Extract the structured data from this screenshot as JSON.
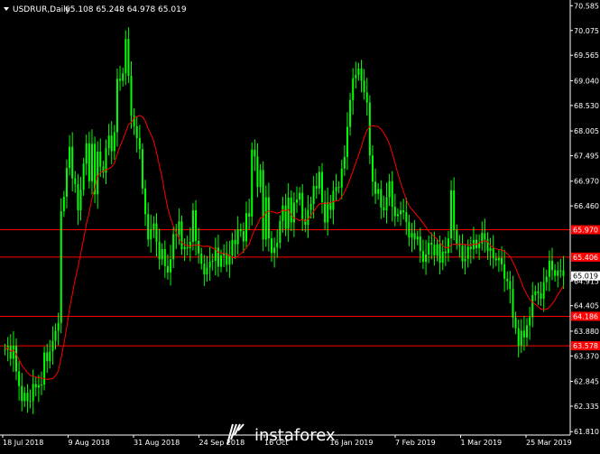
{
  "header": {
    "symbol_timeframe": "USDRUR,Daily",
    "ohlc": "65.108 65.248 64.978 65.019",
    "dropdown_icon": "triangle-down-icon"
  },
  "colors": {
    "background": "#000000",
    "candle": "#00ff00",
    "ma": "#ff0000",
    "hline": "#ff0000",
    "price_badge_bg": "#ffffff",
    "price_badge_text": "#000000",
    "level_badge_bg": "#ff0000",
    "level_badge_text": "#ffffff",
    "axis": "#ffffff",
    "axis_text": "#ffffff",
    "watermark": "#ffffff"
  },
  "watermark": {
    "text": "instaforex",
    "icon": "instaforex-logo-icon"
  },
  "chart_data": {
    "type": "candlestick",
    "timeframe": "Daily",
    "symbol": "USDRUR",
    "last_price": 65.019,
    "ylim": [
      61.74,
      70.61
    ],
    "y_ticks": [
      {
        "value": 70.585,
        "label": "70.585"
      },
      {
        "value": 70.075,
        "label": "70.075"
      },
      {
        "value": 69.565,
        "label": "69.565"
      },
      {
        "value": 69.04,
        "label": "69.040"
      },
      {
        "value": 68.53,
        "label": "68.530"
      },
      {
        "value": 68.005,
        "label": "68.005"
      },
      {
        "value": 67.495,
        "label": "67.495"
      },
      {
        "value": 66.97,
        "label": "66.970"
      },
      {
        "value": 66.46,
        "label": "66.460"
      },
      {
        "value": 64.915,
        "label": "64.915"
      },
      {
        "value": 64.405,
        "label": "64.405"
      },
      {
        "value": 63.88,
        "label": "63.880"
      },
      {
        "value": 63.37,
        "label": "63.370"
      },
      {
        "value": 62.845,
        "label": "62.845"
      },
      {
        "value": 62.335,
        "label": "62.335"
      },
      {
        "value": 61.81,
        "label": "61.810"
      }
    ],
    "levels": [
      {
        "value": 65.97,
        "label": "65.970"
      },
      {
        "value": 65.406,
        "label": "65.406"
      },
      {
        "value": 64.186,
        "label": "64.186"
      },
      {
        "value": 63.578,
        "label": "63.578"
      }
    ],
    "x_labels": [
      "18 Jul 2018",
      "9 Aug 2018",
      "31 Aug 2018",
      "24 Sep 2018",
      "16 Oct",
      "16 Jan 2019",
      "7 Feb 2019",
      "1 Mar 2019",
      "25 Mar 2019"
    ],
    "closes": [
      63.5,
      63.58,
      63.31,
      63.58,
      63.05,
      62.75,
      62.44,
      62.61,
      62.44,
      62.44,
      62.79,
      62.72,
      62.77,
      62.78,
      63.44,
      63.26,
      63.46,
      63.68,
      63.89,
      64.05,
      66.35,
      66.65,
      67.24,
      67.68,
      67.03,
      66.91,
      66.37,
      66.79,
      67.33,
      67.75,
      66.97,
      67.74,
      66.7,
      67.58,
      67.27,
      67.15,
      67.65,
      67.91,
      67.59,
      67.98,
      69.08,
      69.04,
      69.19,
      69.9,
      69.14,
      68.32,
      68.1,
      67.86,
      67.63,
      66.82,
      66.29,
      65.77,
      65.98,
      66.1,
      65.72,
      65.36,
      65.57,
      65.22,
      65.09,
      65.36,
      65.88,
      65.87,
      66.14,
      65.57,
      65.61,
      65.59,
      65.72,
      66.37,
      65.74,
      65.48,
      65.27,
      65.05,
      65.19,
      65.31,
      65.33,
      65.6,
      65.21,
      65.44,
      65.49,
      65.25,
      65.44,
      65.76,
      65.67,
      65.98,
      65.94,
      65.73,
      66.31,
      66.24,
      67.62,
      67.48,
      66.85,
      67.2,
      65.77,
      66.64,
      65.79,
      65.49,
      65.6,
      65.7,
      66.15,
      66.47,
      65.99,
      66.63,
      66.12,
      66.53,
      66.59,
      66.73,
      66.18,
      66.07,
      66.38,
      66.5,
      66.87,
      66.82,
      67.16,
      66.54,
      66.12,
      66.54,
      66.38,
      66.77,
      66.85,
      66.84,
      67.23,
      67.47,
      68.09,
      68.64,
      69.09,
      69.16,
      69.29,
      69.04,
      68.8,
      68.59,
      67.5,
      66.96,
      66.71,
      66.81,
      66.43,
      66.37,
      66.64,
      66.97,
      66.44,
      66.25,
      66.29,
      66.37,
      66.33,
      66.13,
      65.81,
      65.9,
      65.77,
      65.83,
      65.53,
      65.31,
      65.46,
      65.7,
      65.66,
      65.44,
      65.67,
      65.29,
      65.52,
      65.49,
      65.79,
      66.78,
      65.96,
      65.68,
      65.64,
      65.32,
      65.37,
      65.62,
      65.57,
      65.76,
      65.59,
      65.69,
      65.9,
      65.77,
      65.53,
      65.59,
      65.38,
      65.34,
      65.39,
      65.26,
      64.96,
      64.91,
      64.75,
      64.16,
      63.94,
      63.58,
      63.89,
      63.75,
      64.0,
      64.17,
      64.62,
      64.7,
      64.66,
      64.55,
      64.89,
      65.0,
      65.33,
      65.14,
      65.02,
      65.13,
      65.13,
      65.02
    ]
  }
}
